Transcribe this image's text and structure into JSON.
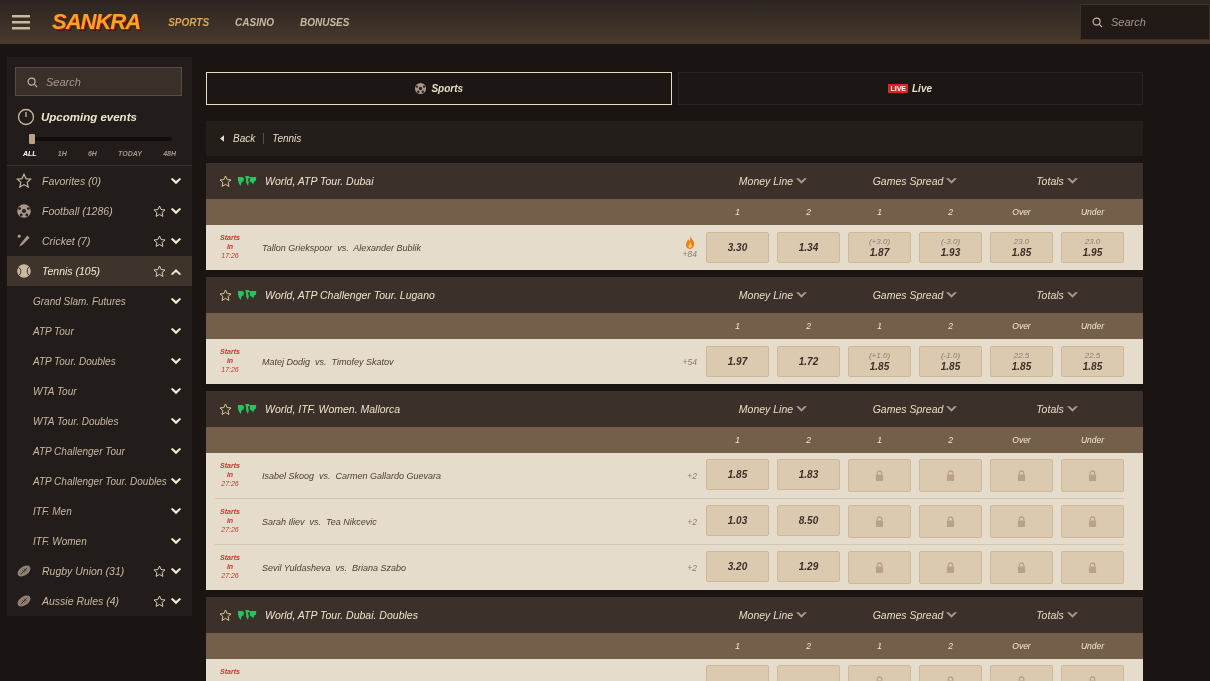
{
  "header": {
    "logo": "SANKRA",
    "nav": [
      {
        "label": "SPORTS",
        "selected": true
      },
      {
        "label": "CASINO",
        "selected": false
      },
      {
        "label": "BONUSES",
        "selected": false
      }
    ],
    "search": {
      "placeholder": "Search"
    }
  },
  "sidebar": {
    "search": {
      "placeholder": "Search"
    },
    "upcoming": {
      "title": "Upcoming events",
      "level": 0,
      "filters": [
        {
          "label": "ALL",
          "selected": true
        },
        {
          "label": "1H",
          "selected": false
        },
        {
          "label": "6H",
          "selected": false
        },
        {
          "label": "TODAY",
          "selected": false
        },
        {
          "label": "48H",
          "selected": false
        }
      ]
    },
    "items": [
      {
        "kind": "favorites",
        "label": "Favorites (0)",
        "favorable": false,
        "selected": false,
        "expanded": false
      },
      {
        "kind": "football",
        "label": "Football (1286)",
        "favorable": true,
        "selected": false,
        "expanded": false
      },
      {
        "kind": "cricket",
        "label": "Cricket (7)",
        "favorable": true,
        "selected": false,
        "expanded": false
      },
      {
        "kind": "tennis",
        "label": "Tennis (105)",
        "favorable": true,
        "selected": true,
        "expanded": true,
        "children": [
          {
            "label": "Grand Slam. Futures"
          },
          {
            "label": "ATP Tour"
          },
          {
            "label": "ATP Tour. Doubles"
          },
          {
            "label": "WTA Tour"
          },
          {
            "label": "WTA Tour. Doubles"
          },
          {
            "label": "ATP Challenger Tour"
          },
          {
            "label": "ATP Challenger Tour. Doubles"
          },
          {
            "label": "ITF. Men"
          },
          {
            "label": "ITF. Women"
          }
        ]
      },
      {
        "kind": "rugby",
        "label": "Rugby Union (31)",
        "favorable": true,
        "selected": false,
        "expanded": false
      },
      {
        "kind": "rugby",
        "label": "Aussie Rules (4)",
        "favorable": true,
        "selected": false,
        "expanded": false
      }
    ]
  },
  "tabs": [
    {
      "kind": "sports",
      "label": "Sports",
      "selected": true
    },
    {
      "kind": "live",
      "label": "Live",
      "badge": "LIVE",
      "selected": false
    }
  ],
  "breadcrumb": {
    "back": "Back",
    "current": "Tennis"
  },
  "sections": [
    {
      "title": "World, ATP Tour. Dubai",
      "markets": [
        "Money Line",
        "Games Spread",
        "Totals"
      ],
      "columns": [
        "1",
        "2",
        "1",
        "2",
        "Over",
        "Under"
      ],
      "events": [
        {
          "start_label": "Starts in",
          "start_time": "17:26",
          "match": "Tallon Griekspoor  vs.  Alexander Bublik",
          "hot": true,
          "more": "+84",
          "odds": [
            {
              "kind": "price",
              "price": "3.30"
            },
            {
              "kind": "price",
              "price": "1.34"
            },
            {
              "kind": "price",
              "line": "(+3.0)",
              "price": "1.87"
            },
            {
              "kind": "price",
              "line": "(-3.0)",
              "price": "1.93"
            },
            {
              "kind": "price",
              "line": "23.0",
              "price": "1.85"
            },
            {
              "kind": "price",
              "line": "23.0",
              "price": "1.95"
            }
          ]
        }
      ]
    },
    {
      "title": "World, ATP Challenger Tour. Lugano",
      "markets": [
        "Money Line",
        "Games Spread",
        "Totals"
      ],
      "columns": [
        "1",
        "2",
        "1",
        "2",
        "Over",
        "Under"
      ],
      "events": [
        {
          "start_label": "Starts in",
          "start_time": "17:26",
          "match": "Matej Dodig  vs.  Timofey Skatov",
          "hot": false,
          "more": "+54",
          "odds": [
            {
              "kind": "price",
              "price": "1.97"
            },
            {
              "kind": "price",
              "price": "1.72"
            },
            {
              "kind": "price",
              "line": "(+1.0)",
              "price": "1.85"
            },
            {
              "kind": "price",
              "line": "(-1.0)",
              "price": "1.85"
            },
            {
              "kind": "price",
              "line": "22.5",
              "price": "1.85"
            },
            {
              "kind": "price",
              "line": "22.5",
              "price": "1.85"
            }
          ]
        }
      ]
    },
    {
      "title": "World, ITF. Women. Mallorca",
      "markets": [
        "Money Line",
        "Games Spread",
        "Totals"
      ],
      "columns": [
        "1",
        "2",
        "1",
        "2",
        "Over",
        "Under"
      ],
      "events": [
        {
          "start_label": "Starts in",
          "start_time": "27:26",
          "match": "Isabel Skoog  vs.  Carmen Gallardo Guevara",
          "hot": false,
          "more": "+2",
          "odds": [
            {
              "kind": "price",
              "price": "1.85"
            },
            {
              "kind": "price",
              "price": "1.83"
            },
            {
              "kind": "lock"
            },
            {
              "kind": "lock"
            },
            {
              "kind": "lock"
            },
            {
              "kind": "lock"
            }
          ]
        },
        {
          "start_label": "Starts in",
          "start_time": "27:26",
          "match": "Sarah Iliev  vs.  Tea Nikcevic",
          "hot": false,
          "more": "+2",
          "odds": [
            {
              "kind": "price",
              "price": "1.03"
            },
            {
              "kind": "price",
              "price": "8.50"
            },
            {
              "kind": "lock"
            },
            {
              "kind": "lock"
            },
            {
              "kind": "lock"
            },
            {
              "kind": "lock"
            }
          ]
        },
        {
          "start_label": "Starts in",
          "start_time": "27:26",
          "match": "Sevil Yuldasheva  vs.  Briana Szabo",
          "hot": false,
          "more": "+2",
          "odds": [
            {
              "kind": "price",
              "price": "3.20"
            },
            {
              "kind": "price",
              "price": "1.29"
            },
            {
              "kind": "lock"
            },
            {
              "kind": "lock"
            },
            {
              "kind": "lock"
            },
            {
              "kind": "lock"
            }
          ]
        }
      ]
    },
    {
      "title": "World, ATP Tour. Dubai. Doubles",
      "markets": [
        "Money Line",
        "Games Spread",
        "Totals"
      ],
      "columns": [
        "1",
        "2",
        "1",
        "2",
        "Over",
        "Under"
      ],
      "events": [
        {
          "start_label": "Starts",
          "hot": false,
          "odds": [
            {
              "kind": "blank"
            },
            {
              "kind": "blank"
            },
            {
              "kind": "lock"
            },
            {
              "kind": "lock"
            },
            {
              "kind": "lock"
            },
            {
              "kind": "lock"
            }
          ]
        }
      ]
    }
  ]
}
